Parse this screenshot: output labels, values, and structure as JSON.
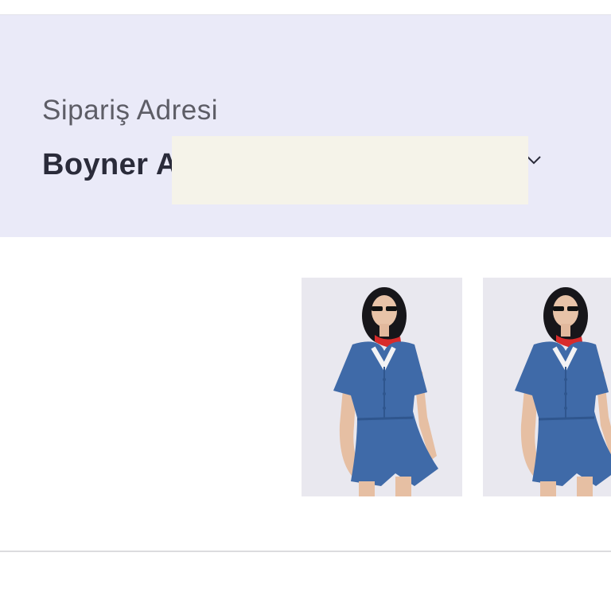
{
  "order_address": {
    "heading": "Sipariş Adresi",
    "selected_address": "Boyner A"
  },
  "products": [
    {
      "image": "product-photo-denim-jumpsuit"
    },
    {
      "image": "product-photo-denim-jumpsuit"
    }
  ],
  "colors": {
    "panel_background": "#eaeaf8",
    "redaction": "#f5f3e9",
    "text_primary": "#2a2b3a",
    "text_secondary": "#5d5d66"
  }
}
